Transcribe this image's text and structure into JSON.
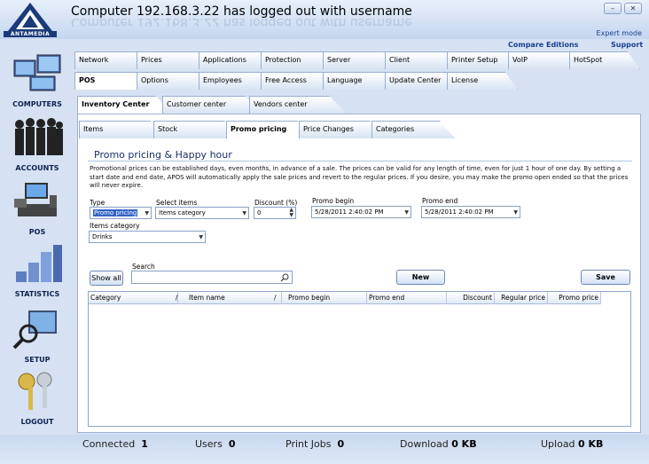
{
  "app": {
    "logo_text": "ANTAMEDIA",
    "title": "Computer 192.168.3.22 has logged out with username",
    "expert_mode": "Expert mode",
    "compare_editions": "Compare Editions",
    "support": "Support",
    "minimize": "–",
    "close": "✕"
  },
  "sidebar": {
    "items": [
      {
        "label": "COMPUTERS"
      },
      {
        "label": "ACCOUNTS"
      },
      {
        "label": "POS"
      },
      {
        "label": "STATISTICS"
      },
      {
        "label": "SETUP"
      },
      {
        "label": "LOGOUT"
      }
    ]
  },
  "tabs_row1": [
    "Network",
    "Prices",
    "Applications",
    "Protection",
    "Server",
    "Client",
    "Printer Setup",
    "VoIP",
    "HotSpot"
  ],
  "tabs_row2": [
    "POS",
    "Options",
    "Employees",
    "Free Access",
    "Language",
    "Update Center",
    "License"
  ],
  "tabs_row3": [
    "Inventory Center",
    "Customer center",
    "Vendors center"
  ],
  "tabs_row4": [
    "Items",
    "Stock",
    "Promo pricing",
    "Price Changes",
    "Categories"
  ],
  "promo": {
    "heading": "Promo pricing & Happy hour",
    "description": "Promotional prices can be established days, even months, in advance of a sale.  The prices can be valid for any length of time, even for just 1 hour of one day.  By setting a start date and end date, APOS will automatically apply the sale prices and revert to the regular prices.  If you desire, you may make the promo open ended so that the prices will never expire.",
    "type_label": "Type",
    "type_value": "Promo pricing",
    "select_items_label": "Select items",
    "select_items_value": "Items category",
    "discount_label": "Discount (%)",
    "discount_value": "0",
    "promo_begin_label": "Promo begin",
    "promo_begin_value": "5/28/2011 2:40:02 PM",
    "promo_end_label": "Promo end",
    "promo_end_value": "5/28/2011 2:40:02 PM",
    "items_category_label": "Items category",
    "items_category_value": "Drinks",
    "search_label": "Search",
    "search_value": "",
    "show_all": "Show all",
    "new": "New",
    "save": "Save"
  },
  "grid": {
    "columns": [
      "Category",
      "/",
      "Item name",
      "/",
      "Promo begin",
      "Promo end",
      "Discount",
      "Regular price",
      "Promo price"
    ],
    "rows": []
  },
  "status": {
    "connected_label": "Connected",
    "connected_value": "1",
    "users_label": "Users",
    "users_value": "0",
    "print_label": "Print Jobs",
    "print_value": "0",
    "download_label": "Download",
    "download_value": "0 KB",
    "upload_label": "Upload",
    "upload_value": "0 KB"
  }
}
